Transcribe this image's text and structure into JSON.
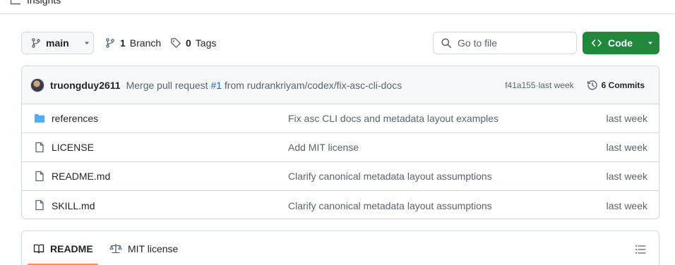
{
  "nav": {
    "tab_label": "Insights"
  },
  "toolbar": {
    "branch_name": "main",
    "branch_count": "1",
    "branch_label": "Branch",
    "tag_count": "0",
    "tag_label": "Tags",
    "goto_placeholder": "Go to file",
    "code_label": "Code"
  },
  "commit": {
    "author": "truongduy2611",
    "message_prefix": "Merge pull request ",
    "pr_link": "#1",
    "message_suffix": " from rudrankriyam/codex/fix-asc-cli-docs",
    "hash": "f41a155",
    "separator": " · ",
    "time": "last week",
    "commits_label": "6 Commits"
  },
  "files": [
    {
      "icon": "folder-icon",
      "name": "references",
      "message": "Fix asc CLI docs and metadata layout examples",
      "date": "last week"
    },
    {
      "icon": "file-icon",
      "name": "LICENSE",
      "message": "Add MIT license",
      "date": "last week"
    },
    {
      "icon": "file-icon",
      "name": "README.md",
      "message": "Clarify canonical metadata layout assumptions",
      "date": "last week"
    },
    {
      "icon": "file-icon",
      "name": "SKILL.md",
      "message": "Clarify canonical metadata layout assumptions",
      "date": "last week"
    }
  ],
  "readme_tabs": {
    "readme_label": "README",
    "license_label": "MIT license"
  },
  "colors": {
    "accent_green": "#1f883d",
    "link_blue": "#0969da",
    "folder_blue": "#54aeff",
    "tab_underline": "#fd8c73"
  }
}
